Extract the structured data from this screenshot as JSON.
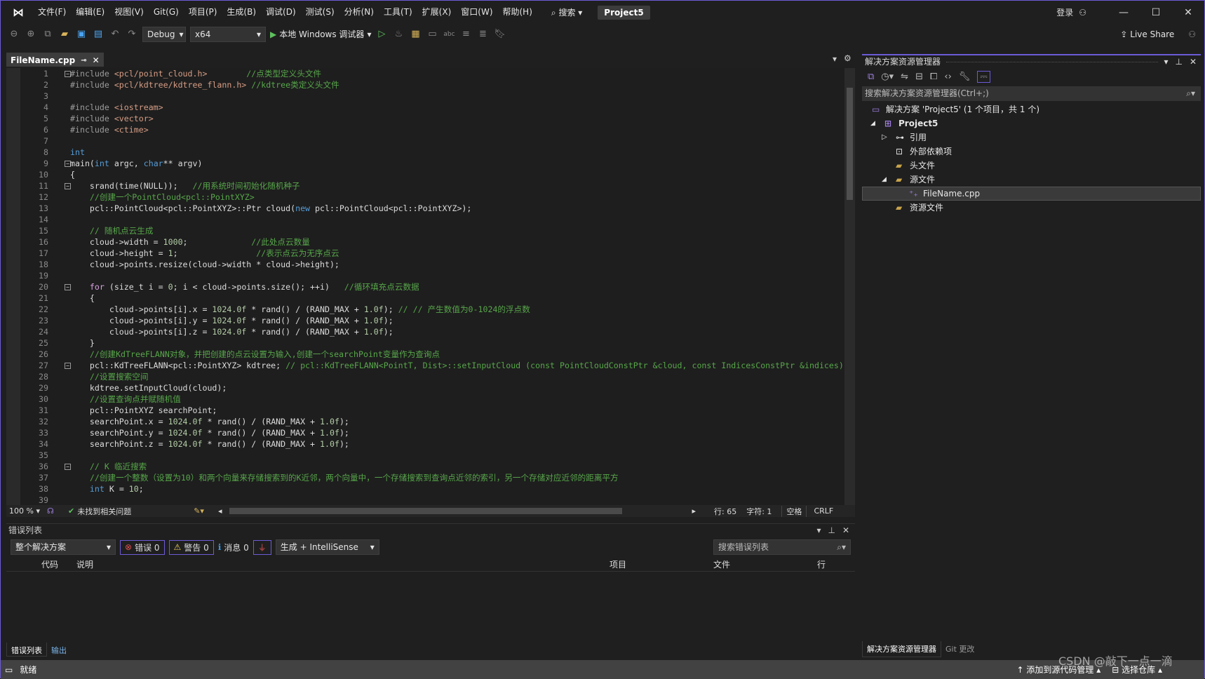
{
  "titlebar": {
    "menus": [
      "文件(F)",
      "编辑(E)",
      "视图(V)",
      "Git(G)",
      "项目(P)",
      "生成(B)",
      "调试(D)",
      "测试(S)",
      "分析(N)",
      "工具(T)",
      "扩展(X)",
      "窗口(W)",
      "帮助(H)"
    ],
    "search": "搜索",
    "project": "Project5",
    "login": "登录"
  },
  "toolbar": {
    "config": "Debug",
    "platform": "x64",
    "run": "本地 Windows 调试器",
    "live_share": "Live Share"
  },
  "tab": {
    "name": "FileName.cpp"
  },
  "editor": {
    "lines": [
      [
        {
          "t": "#include ",
          "c": "pp"
        },
        {
          "t": "<pcl/point_cloud.h>",
          "c": "str"
        },
        {
          "t": "        ",
          "c": "tx"
        },
        {
          "t": "//点类型定义头文件",
          "c": "cm"
        }
      ],
      [
        {
          "t": "#include ",
          "c": "pp"
        },
        {
          "t": "<pcl/kdtree/kdtree_flann.h>",
          "c": "str"
        },
        {
          "t": " ",
          "c": "tx"
        },
        {
          "t": "//kdtree类定义头文件",
          "c": "cm"
        }
      ],
      [],
      [
        {
          "t": "#include ",
          "c": "pp"
        },
        {
          "t": "<iostream>",
          "c": "str"
        }
      ],
      [
        {
          "t": "#include ",
          "c": "pp"
        },
        {
          "t": "<vector>",
          "c": "str"
        }
      ],
      [
        {
          "t": "#include ",
          "c": "pp"
        },
        {
          "t": "<ctime>",
          "c": "str"
        }
      ],
      [],
      [
        {
          "t": "int",
          "c": "kw"
        }
      ],
      [
        {
          "t": "main(",
          "c": "tx"
        },
        {
          "t": "int",
          "c": "kw"
        },
        {
          "t": " argc, ",
          "c": "tx"
        },
        {
          "t": "char",
          "c": "kw"
        },
        {
          "t": "** argv)",
          "c": "tx"
        }
      ],
      [
        {
          "t": "{",
          "c": "tx"
        }
      ],
      [
        {
          "t": "    srand(time(NULL));   ",
          "c": "tx"
        },
        {
          "t": "//用系统时间初始化随机种子",
          "c": "cm"
        }
      ],
      [
        {
          "t": "    ",
          "c": "tx"
        },
        {
          "t": "//创建一个PointCloud<pcl::PointXYZ>",
          "c": "cm"
        }
      ],
      [
        {
          "t": "    pcl::PointCloud<pcl::PointXYZ>::Ptr cloud(",
          "c": "tx"
        },
        {
          "t": "new",
          "c": "kw"
        },
        {
          "t": " pcl::PointCloud<pcl::PointXYZ>);",
          "c": "tx"
        }
      ],
      [],
      [
        {
          "t": "    ",
          "c": "tx"
        },
        {
          "t": "// 随机点云生成",
          "c": "cm"
        }
      ],
      [
        {
          "t": "    cloud->width = ",
          "c": "tx"
        },
        {
          "t": "1000",
          "c": "num"
        },
        {
          "t": ";             ",
          "c": "tx"
        },
        {
          "t": "//此处点云数量",
          "c": "cm"
        }
      ],
      [
        {
          "t": "    cloud->height = ",
          "c": "tx"
        },
        {
          "t": "1",
          "c": "num"
        },
        {
          "t": ";                ",
          "c": "tx"
        },
        {
          "t": "//表示点云为无序点云",
          "c": "cm"
        }
      ],
      [
        {
          "t": "    cloud->points.resize(cloud->width * cloud->height);",
          "c": "tx"
        }
      ],
      [],
      [
        {
          "t": "    ",
          "c": "tx"
        },
        {
          "t": "for",
          "c": "ctl"
        },
        {
          "t": " (size_t i = ",
          "c": "tx"
        },
        {
          "t": "0",
          "c": "num"
        },
        {
          "t": "; i < cloud->points.size(); ++i)   ",
          "c": "tx"
        },
        {
          "t": "//循环填充点云数据",
          "c": "cm"
        }
      ],
      [
        {
          "t": "    {",
          "c": "tx"
        }
      ],
      [
        {
          "t": "        cloud->points[i].x = ",
          "c": "tx"
        },
        {
          "t": "1024.0f",
          "c": "num"
        },
        {
          "t": " * rand() / (RAND_MAX + ",
          "c": "tx"
        },
        {
          "t": "1.0f",
          "c": "num"
        },
        {
          "t": "); ",
          "c": "tx"
        },
        {
          "t": "// // 产生数值为0-1024的浮点数",
          "c": "cm"
        }
      ],
      [
        {
          "t": "        cloud->points[i].y = ",
          "c": "tx"
        },
        {
          "t": "1024.0f",
          "c": "num"
        },
        {
          "t": " * rand() / (RAND_MAX + ",
          "c": "tx"
        },
        {
          "t": "1.0f",
          "c": "num"
        },
        {
          "t": ");",
          "c": "tx"
        }
      ],
      [
        {
          "t": "        cloud->points[i].z = ",
          "c": "tx"
        },
        {
          "t": "1024.0f",
          "c": "num"
        },
        {
          "t": " * rand() / (RAND_MAX + ",
          "c": "tx"
        },
        {
          "t": "1.0f",
          "c": "num"
        },
        {
          "t": ");",
          "c": "tx"
        }
      ],
      [
        {
          "t": "    }",
          "c": "tx"
        }
      ],
      [
        {
          "t": "    ",
          "c": "tx"
        },
        {
          "t": "//创建KdTreeFLANN对象，并把创建的点云设置为输入,创建一个searchPoint变量作为查询点",
          "c": "cm"
        }
      ],
      [
        {
          "t": "    pcl::KdTreeFLANN<pcl::PointXYZ> kdtree; ",
          "c": "tx"
        },
        {
          "t": "// pcl::KdTreeFLANN<PointT, Dist>::setInputCloud (const PointCloudConstPtr &cloud, const IndicesConstPtr &indices)",
          "c": "cm"
        }
      ],
      [
        {
          "t": "    ",
          "c": "tx"
        },
        {
          "t": "//设置搜索空间",
          "c": "cm"
        }
      ],
      [
        {
          "t": "    kdtree.setInputCloud(cloud);",
          "c": "tx"
        }
      ],
      [
        {
          "t": "    ",
          "c": "tx"
        },
        {
          "t": "//设置查询点并赋随机值",
          "c": "cm"
        }
      ],
      [
        {
          "t": "    pcl::PointXYZ searchPoint;",
          "c": "tx"
        }
      ],
      [
        {
          "t": "    searchPoint.x = ",
          "c": "tx"
        },
        {
          "t": "1024.0f",
          "c": "num"
        },
        {
          "t": " * rand() / (RAND_MAX + ",
          "c": "tx"
        },
        {
          "t": "1.0f",
          "c": "num"
        },
        {
          "t": ");",
          "c": "tx"
        }
      ],
      [
        {
          "t": "    searchPoint.y = ",
          "c": "tx"
        },
        {
          "t": "1024.0f",
          "c": "num"
        },
        {
          "t": " * rand() / (RAND_MAX + ",
          "c": "tx"
        },
        {
          "t": "1.0f",
          "c": "num"
        },
        {
          "t": ");",
          "c": "tx"
        }
      ],
      [
        {
          "t": "    searchPoint.z = ",
          "c": "tx"
        },
        {
          "t": "1024.0f",
          "c": "num"
        },
        {
          "t": " * rand() / (RAND_MAX + ",
          "c": "tx"
        },
        {
          "t": "1.0f",
          "c": "num"
        },
        {
          "t": ");",
          "c": "tx"
        }
      ],
      [],
      [
        {
          "t": "    ",
          "c": "tx"
        },
        {
          "t": "// K 临近搜索",
          "c": "cm"
        }
      ],
      [
        {
          "t": "    ",
          "c": "tx"
        },
        {
          "t": "//创建一个整数（设置为10）和两个向量来存储搜索到的K近邻，两个向量中，一个存储搜索到查询点近邻的索引，另一个存储对应近邻的距离平方",
          "c": "cm"
        }
      ],
      [
        {
          "t": "    ",
          "c": "tx"
        },
        {
          "t": "int",
          "c": "kw"
        },
        {
          "t": " K = ",
          "c": "tx"
        },
        {
          "t": "10",
          "c": "num"
        },
        {
          "t": ";",
          "c": "tx"
        }
      ],
      []
    ],
    "fold_lines": [
      1,
      9,
      11,
      20,
      27,
      36
    ]
  },
  "editor_status": {
    "zoom": "100 %",
    "issues": "未找到相关问题",
    "line": "行: 65",
    "char": "字符: 1",
    "spaces": "空格",
    "eol": "CRLF"
  },
  "error_list": {
    "title": "错误列表",
    "scope": "整个解决方案",
    "errors": "错误 0",
    "warnings": "警告 0",
    "messages": "消息 0",
    "source": "生成 + IntelliSense",
    "search_placeholder": "搜索错误列表",
    "columns": [
      "代码",
      "说明",
      "项目",
      "文件",
      "行"
    ]
  },
  "bottom_tabs": [
    "错误列表",
    "输出"
  ],
  "solution_explorer": {
    "title": "解决方案资源管理器",
    "search_placeholder": "搜索解决方案资源管理器(Ctrl+;)",
    "items": [
      {
        "label": "解决方案 'Project5' (1 个项目，共 1 个)"
      },
      {
        "label": "Project5"
      },
      {
        "label": "引用"
      },
      {
        "label": "外部依赖项"
      },
      {
        "label": "头文件"
      },
      {
        "label": "源文件"
      },
      {
        "label": "FileName.cpp"
      },
      {
        "label": "资源文件"
      }
    ],
    "tabs": [
      "解决方案资源管理器",
      "Git 更改"
    ]
  },
  "statusbar": {
    "ready": "就绪",
    "source_control": "添加到源代码管理",
    "repo": "选择仓库"
  },
  "watermark": "CSDN @敲下一点一滴"
}
